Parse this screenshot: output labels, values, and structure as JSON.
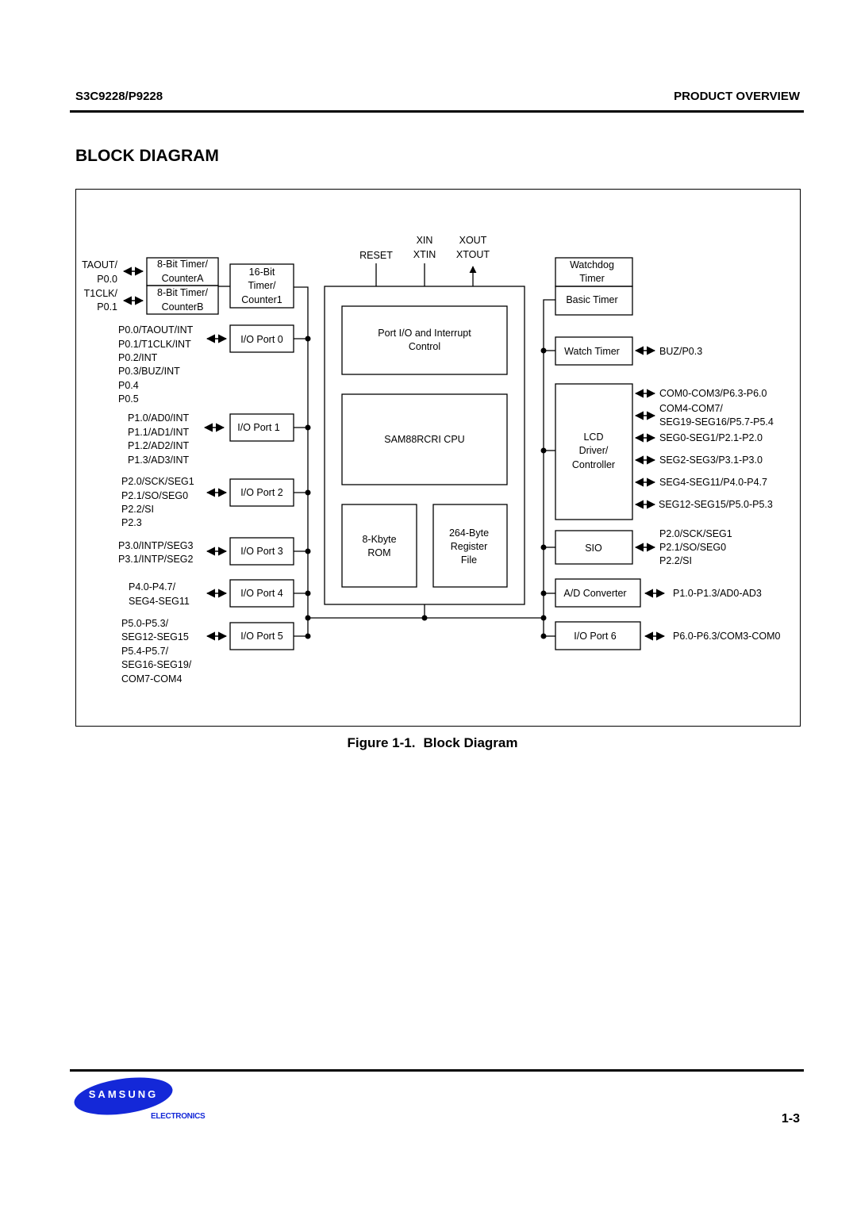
{
  "header": {
    "part_number": "S3C9228/P9228",
    "section": "PRODUCT OVERVIEW"
  },
  "title": "BLOCK DIAGRAM",
  "caption": {
    "figure": "Figure 1-1.",
    "text": "Block Diagram"
  },
  "footer": {
    "brand": "SAMSUNG",
    "division": "ELECTRONICS",
    "page": "1-3"
  },
  "diagram": {
    "top_signals": {
      "reset": "RESET",
      "xin": "XIN",
      "xtin": "XTIN",
      "xout": "XOUT",
      "xtout": "XTOUT"
    },
    "timers_left": {
      "timer_a": [
        "8-Bit Timer/",
        "CounterA"
      ],
      "timer_b": [
        "8-Bit Timer/",
        "CounterB"
      ],
      "timer_a_pins": [
        "TAOUT/",
        "P0.0"
      ],
      "timer_b_pins": [
        "T1CLK/",
        "P0.1"
      ],
      "timer1": [
        "16-Bit",
        "Timer/",
        "Counter1"
      ]
    },
    "io_ports_left": [
      {
        "label": "I/O Port 0",
        "pins": [
          "P0.0/TAOUT/INT",
          "P0.1/T1CLK/INT",
          "P0.2/INT",
          "P0.3/BUZ/INT",
          "P0.4",
          "P0.5"
        ]
      },
      {
        "label": "I/O Port 1",
        "pins": [
          "P1.0/AD0/INT",
          "P1.1/AD1/INT",
          "P1.2/AD2/INT",
          "P1.3/AD3/INT"
        ]
      },
      {
        "label": "I/O Port 2",
        "pins": [
          "P2.0/SCK/SEG1",
          "P2.1/SO/SEG0",
          "P2.2/SI",
          "P2.3"
        ]
      },
      {
        "label": "I/O Port 3",
        "pins": [
          "P3.0/INTP/SEG3",
          "P3.1/INTP/SEG2"
        ]
      },
      {
        "label": "I/O Port 4",
        "pins": [
          "P4.0-P4.7/",
          "SEG4-SEG11"
        ]
      },
      {
        "label": "I/O Port 5",
        "pins": [
          "P5.0-P5.3/",
          "SEG12-SEG15",
          "P5.4-P5.7/",
          "SEG16-SEG19/",
          "COM7-COM4"
        ]
      }
    ],
    "core": {
      "interrupt": [
        "Port I/O and Interrupt",
        "Control"
      ],
      "cpu": "SAM88RCRI CPU",
      "rom": [
        "8-Kbyte",
        "ROM"
      ],
      "regfile": [
        "264-Byte",
        "Register",
        "File"
      ]
    },
    "right_blocks": {
      "watchdog": [
        "Watchdog",
        "Timer"
      ],
      "basic_timer": "Basic Timer",
      "watch_timer": "Watch Timer",
      "watch_timer_pin": "BUZ/P0.3",
      "lcd": [
        "LCD",
        "Driver/",
        "Controller"
      ],
      "lcd_pins": [
        [
          "COM0-COM3/P6.3-P6.0"
        ],
        [
          "COM4-COM7/",
          "SEG19-SEG16/P5.7-P5.4"
        ],
        [
          "SEG0-SEG1/P2.1-P2.0"
        ],
        [
          "SEG2-SEG3/P3.1-P3.0"
        ],
        [
          "SEG4-SEG11/P4.0-P4.7"
        ],
        [
          "SEG12-SEG15/P5.0-P5.3"
        ]
      ],
      "sio": "SIO",
      "sio_pins": [
        "P2.0/SCK/SEG1",
        "P2.1/SO/SEG0",
        "P2.2/SI"
      ],
      "adc": "A/D Converter",
      "adc_pin": "P1.0-P1.3/AD0-AD3",
      "port6": "I/O Port 6",
      "port6_pin": "P6.0-P6.3/COM3-COM0"
    }
  }
}
